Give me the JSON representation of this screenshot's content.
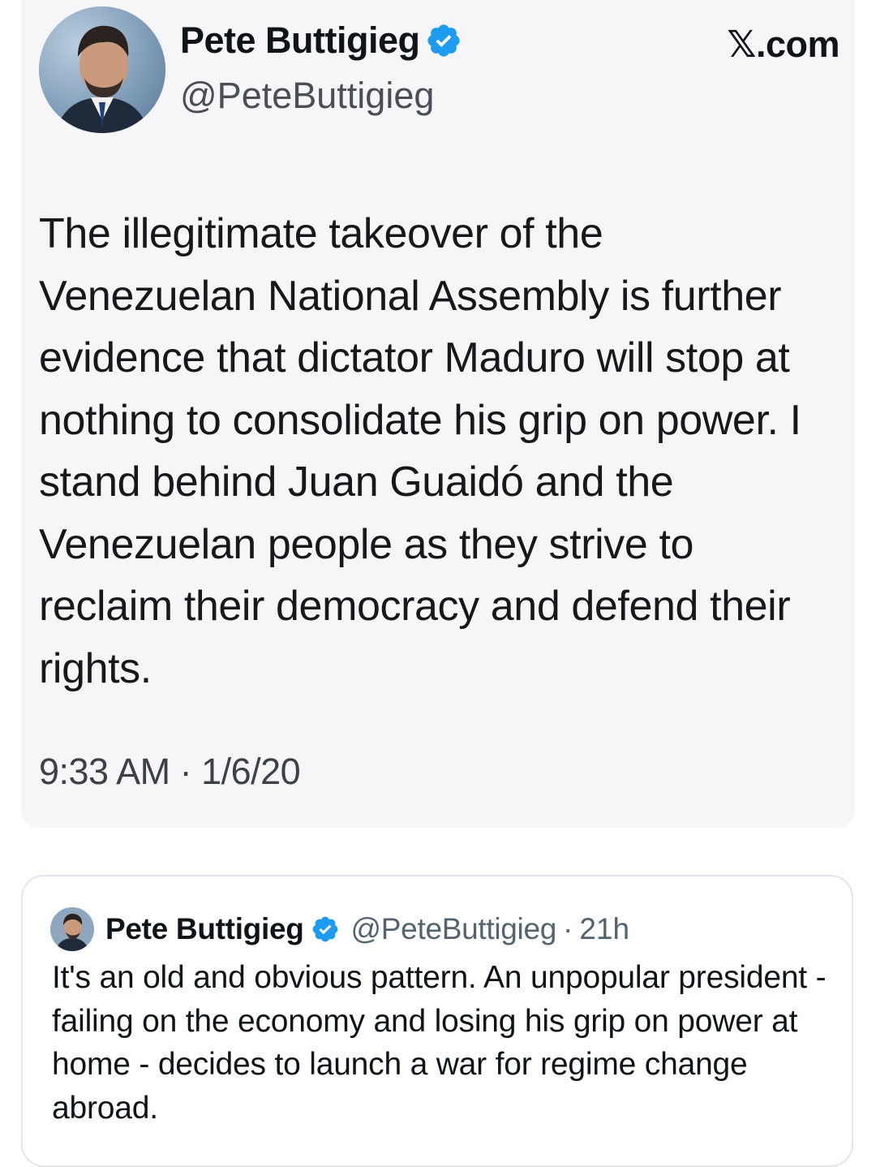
{
  "original_tweet": {
    "author": {
      "display_name": "Pete Buttigieg",
      "handle": "@PeteButtigieg",
      "verified_icon": "verified-badge-icon",
      "avatar_icon": "profile-photo"
    },
    "site_label": "𝕏.com",
    "text": "The illegitimate takeover of the Venezuelan National Assembly is further evidence that dictator Maduro will stop at nothing to consolidate his grip on power. I stand behind Juan Guaidó and the Venezuelan people as they strive to reclaim their democracy and defend their rights.",
    "timestamp": "9:33 AM · 1/6/20"
  },
  "quoted_tweet": {
    "author": {
      "display_name": "Pete Buttigieg",
      "handle": "@PeteButtigieg",
      "verified_icon": "verified-badge-icon",
      "avatar_icon": "profile-photo"
    },
    "separator": "·",
    "age": "21h",
    "text": "It's an old and obvious pattern. An unpopular president - failing on the economy and losing his grip on power at home - decides to launch a war for regime change abroad."
  },
  "colors": {
    "verified_blue": "#1d9bf0",
    "card_background": "#f6f6f8",
    "secondary_text": "#536471"
  }
}
